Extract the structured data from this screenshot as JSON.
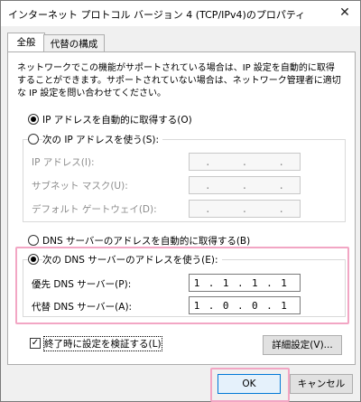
{
  "window": {
    "title": "インターネット プロトコル バージョン 4 (TCP/IPv4)のプロパティ",
    "close_glyph": "✕"
  },
  "tabs": [
    {
      "label": "全般"
    },
    {
      "label": "代替の構成"
    }
  ],
  "description": "ネットワークでこの機能がサポートされている場合は、IP 設定を自動的に取得することができます。サポートされていない場合は、ネットワーク管理者に適切な IP 設定を問い合わせてください。",
  "ip_section": {
    "auto_label": "IP アドレスを自動的に取得する(O)",
    "manual_label": "次の IP アドレスを使う(S):",
    "fields": [
      {
        "label": "IP アドレス(I):",
        "value": [
          ".",
          ".",
          "."
        ]
      },
      {
        "label": "サブネット マスク(U):",
        "value": [
          ".",
          ".",
          "."
        ]
      },
      {
        "label": "デフォルト ゲートウェイ(D):",
        "value": [
          ".",
          ".",
          "."
        ]
      }
    ]
  },
  "dns_section": {
    "auto_label": "DNS サーバーのアドレスを自動的に取得する(B)",
    "manual_label": "次の DNS サーバーのアドレスを使う(E):",
    "preferred": {
      "label": "優先 DNS サーバー(P):",
      "octets": [
        "1",
        ".",
        "1",
        ".",
        "1",
        ".",
        "1"
      ]
    },
    "alternate": {
      "label": "代替 DNS サーバー(A):",
      "octets": [
        "1",
        ".",
        "0",
        ".",
        "0",
        ".",
        "1"
      ]
    }
  },
  "validate_label": "終了時に設定を検証する(L)",
  "validate_check_glyph": "✓",
  "advanced_button": "詳細設定(V)...",
  "ok_button": "OK",
  "cancel_button": "キャンセル",
  "colors": {
    "highlight": "#f2a6c4",
    "default_button_border": "#0078d7"
  }
}
